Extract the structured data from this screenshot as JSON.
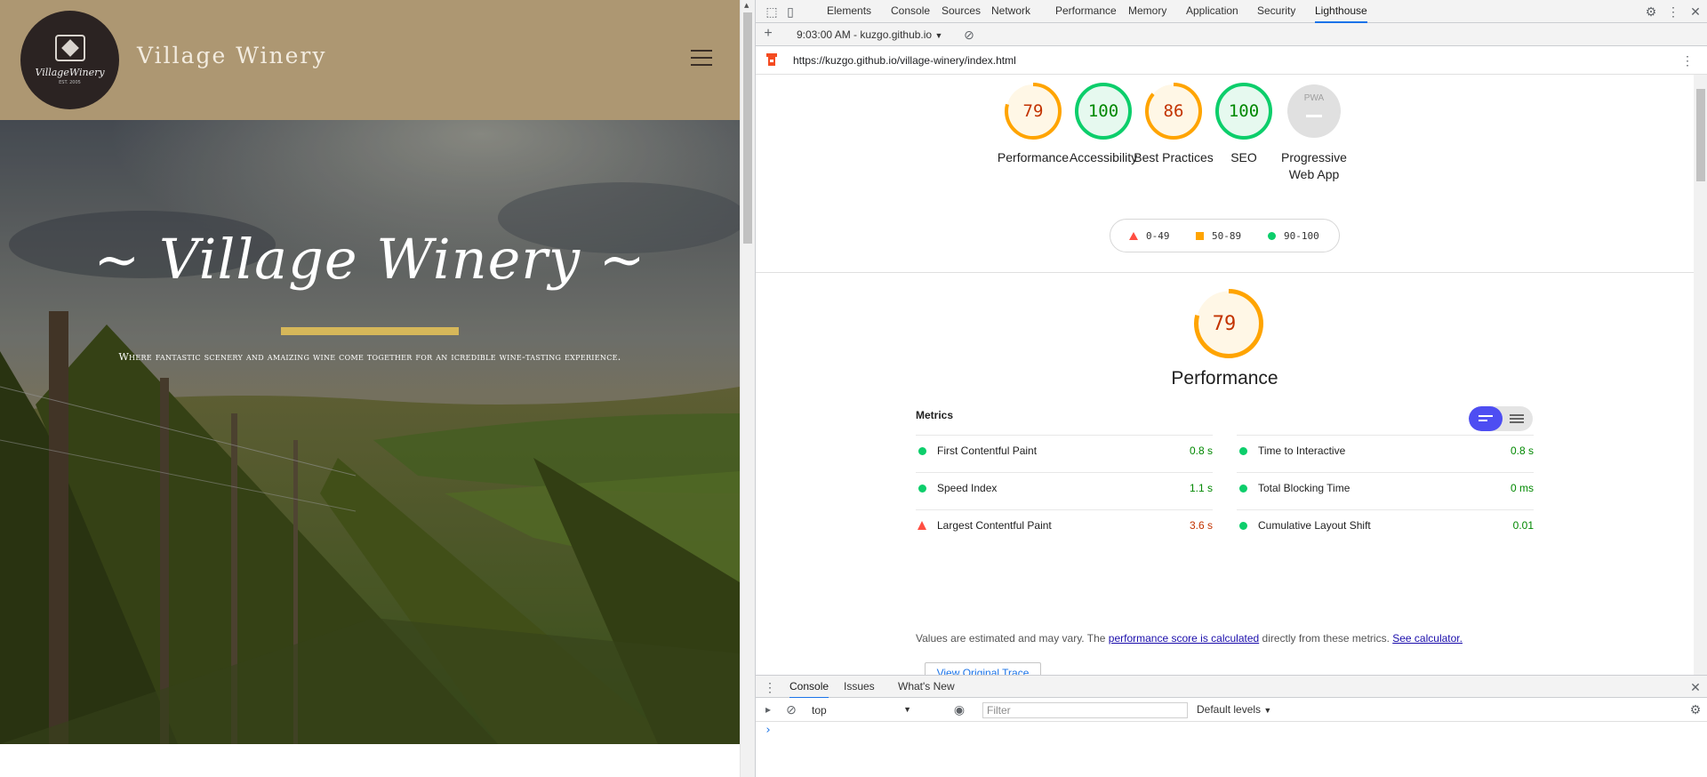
{
  "site": {
    "title": "Village Winery",
    "logo_text": "VillageWinery",
    "logo_sub": "EST. 2005",
    "hero_title": "~ Village Winery ~",
    "hero_tagline": "Where fantastic scenery and amaizing wine come together for an icredible wine-tasting experience."
  },
  "devtools": {
    "tabs": [
      "Elements",
      "Console",
      "Sources",
      "Network",
      "Performance",
      "Memory",
      "Application",
      "Security",
      "Lighthouse"
    ],
    "active_tab": "Lighthouse",
    "toolbar": {
      "report_select": "9:03:00 AM - kuzgo.github.io"
    },
    "url": "https://kuzgo.github.io/village-winery/index.html",
    "gauges": [
      {
        "score": "79",
        "label": "Performance",
        "value": 0.79,
        "color": "#ffa400",
        "fill": "#fff7e6"
      },
      {
        "score": "100",
        "label": "Accessibility",
        "value": 1.0,
        "color": "#0cce6b",
        "fill": "#e6f9ef"
      },
      {
        "score": "86",
        "label": "Best Practices",
        "value": 0.86,
        "color": "#ffa400",
        "fill": "#fff7e6"
      },
      {
        "score": "100",
        "label": "SEO",
        "value": 1.0,
        "color": "#0cce6b",
        "fill": "#e6f9ef"
      },
      {
        "score": "PWA",
        "label": "Progressive Web App",
        "value": 0,
        "color": "#bdbdbd",
        "fill": "#e0e0e0"
      }
    ],
    "legend": [
      {
        "range": "0-49",
        "shape": "triangle",
        "color": "#ff4e42"
      },
      {
        "range": "50-89",
        "shape": "square",
        "color": "#ffa400"
      },
      {
        "range": "90-100",
        "shape": "circle",
        "color": "#0cce6b"
      }
    ],
    "performance": {
      "score": "79",
      "value": 0.79,
      "title": "Performance",
      "metrics_label": "Metrics",
      "metrics_left": [
        {
          "name": "First Contentful Paint",
          "value": "0.8 s",
          "status": "pass"
        },
        {
          "name": "Speed Index",
          "value": "1.1 s",
          "status": "pass"
        },
        {
          "name": "Largest Contentful Paint",
          "value": "3.6 s",
          "status": "fail"
        }
      ],
      "metrics_right": [
        {
          "name": "Time to Interactive",
          "value": "0.8 s",
          "status": "pass"
        },
        {
          "name": "Total Blocking Time",
          "value": "0 ms",
          "status": "pass"
        },
        {
          "name": "Cumulative Layout Shift",
          "value": "0.01",
          "status": "pass"
        }
      ],
      "note_prefix": "Values are estimated and may vary. The ",
      "note_link1": "performance score is calculated",
      "note_middle": " directly from these metrics. ",
      "note_link2": "See calculator.",
      "trace_button": "View Original Trace",
      "pass_color": "#0cce6b",
      "fail_color": "#ff4e42"
    },
    "drawer": {
      "tabs": [
        "Console",
        "Issues",
        "What's New"
      ],
      "active_tab": "Console",
      "context": "top",
      "filter_placeholder": "Filter",
      "levels": "Default levels",
      "prompt": "›"
    }
  }
}
